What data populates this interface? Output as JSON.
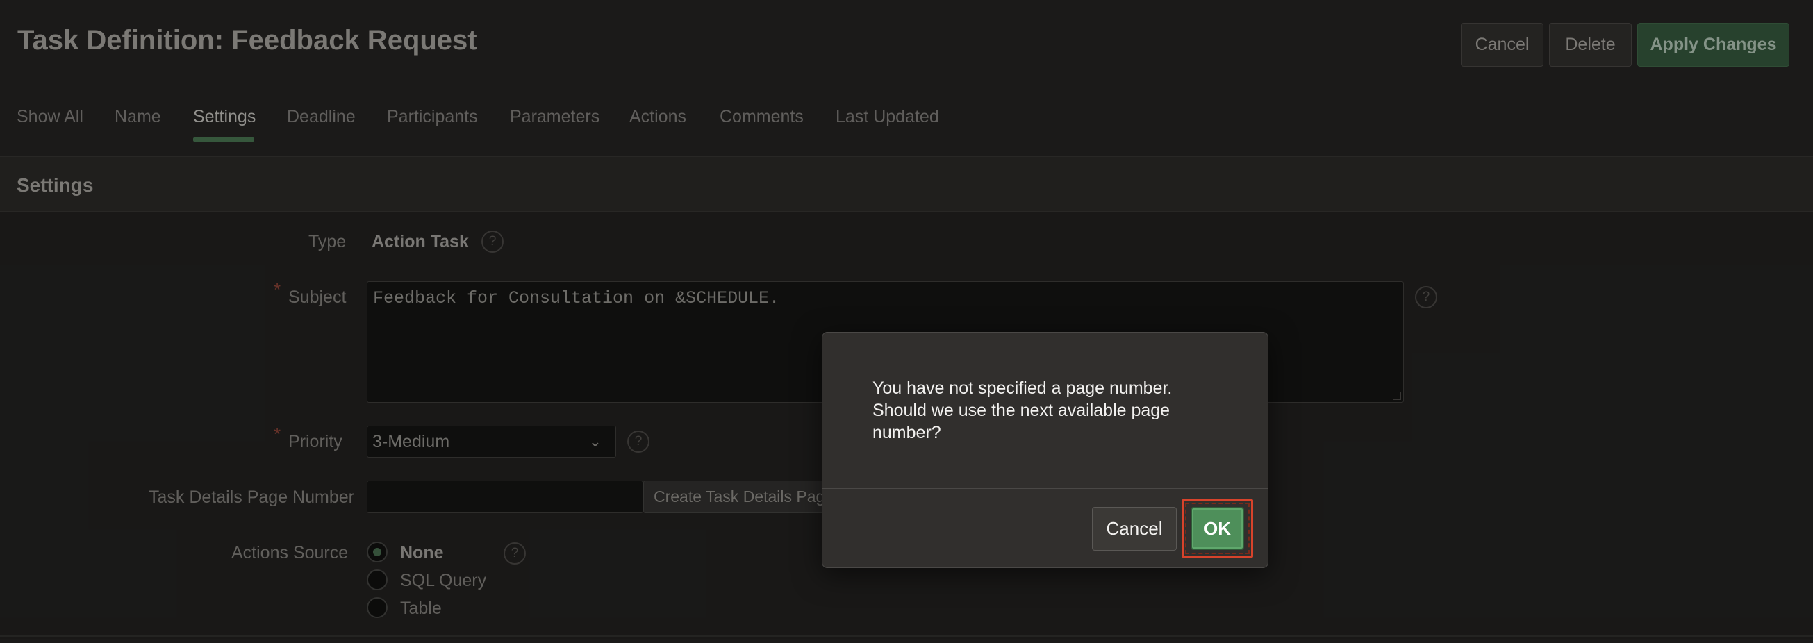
{
  "header": {
    "title": "Task Definition: Feedback Request",
    "cancel_label": "Cancel",
    "delete_label": "Delete",
    "apply_label": "Apply Changes"
  },
  "tabs": [
    {
      "label": "Show All"
    },
    {
      "label": "Name"
    },
    {
      "label": "Settings"
    },
    {
      "label": "Deadline"
    },
    {
      "label": "Participants"
    },
    {
      "label": "Parameters"
    },
    {
      "label": "Actions"
    },
    {
      "label": "Comments"
    },
    {
      "label": "Last Updated"
    }
  ],
  "active_tab": "Settings",
  "region": {
    "title": "Settings",
    "type": {
      "label": "Type",
      "value": "Action Task"
    },
    "subject": {
      "label": "Subject",
      "required_mark": "*",
      "value": "Feedback for Consultation on &SCHEDULE."
    },
    "priority": {
      "label": "Priority",
      "required_mark": "*",
      "value": "3-Medium"
    },
    "task_details_page": {
      "label": "Task Details Page Number",
      "value": "",
      "button_label": "Create Task Details Page"
    },
    "actions_source": {
      "label": "Actions Source",
      "options": [
        "None",
        "SQL Query",
        "Table"
      ],
      "selected": "None"
    },
    "help_glyph": "?"
  },
  "dialog": {
    "message": "You have not specified a page number. Should we use the next available page number?",
    "cancel_label": "Cancel",
    "ok_label": "OK"
  },
  "colors": {
    "background": "#1f1e1d",
    "primary_button": "#2d4a34",
    "dialog_ok": "#4e8f5a",
    "focus_highlight": "#d7432b"
  }
}
